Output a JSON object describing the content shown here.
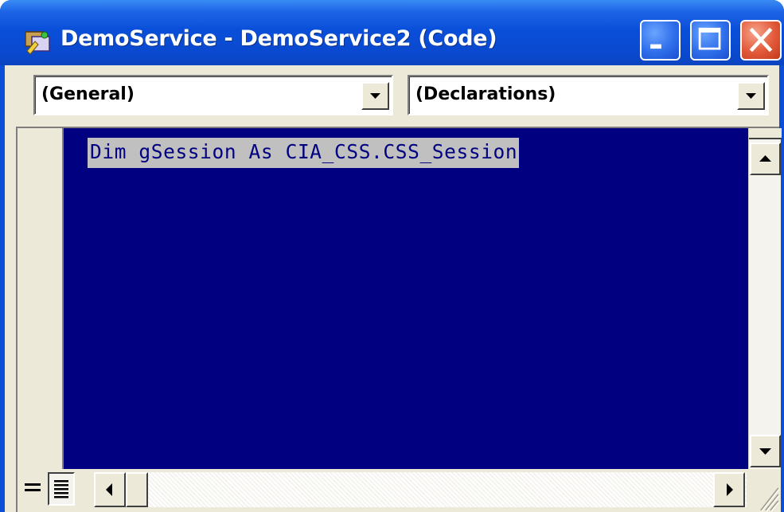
{
  "window": {
    "title": "DemoService - DemoService2 (Code)",
    "icon": "vb-project-icon",
    "controls": [
      "minimize-icon",
      "maximize-icon",
      "close-icon"
    ]
  },
  "dropdowns": {
    "object": {
      "selected": "(General)"
    },
    "procedure": {
      "selected": "(Declarations)"
    }
  },
  "editor": {
    "lines": [
      "Dim gSession As CIA_CSS.CSS_Session"
    ],
    "background": "#000080",
    "selection_color": "#c0c0c0"
  },
  "view_buttons": [
    "procedure-view-icon",
    "full-module-view-icon"
  ],
  "colors": {
    "titlebar": "#0a4fd9",
    "close_button": "#e2593a",
    "chrome": "#ece9d8"
  }
}
